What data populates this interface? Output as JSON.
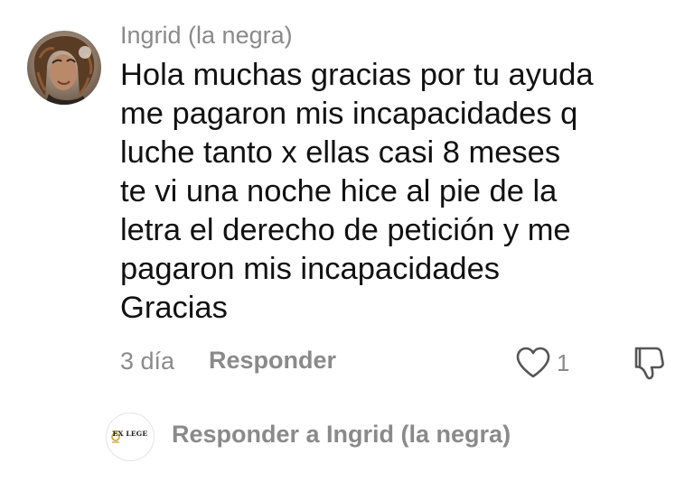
{
  "comment": {
    "author": "Ingrid (la negra)",
    "text": "Hola muchas gracias por tu ayuda\nme pagaron mis incapacidades q\nluche tanto x ellas casi 8 meses\nte vi una noche hice al pie de la\nletra el derecho de petición y me\npagaron mis incapacidades\nGracias",
    "time": "3 día",
    "reply_label": "Responder",
    "like_count": "1"
  },
  "reply_box": {
    "avatar_logo_text": "EX LEGE",
    "placeholder": "Responder a Ingrid (la negra)"
  },
  "icons": {
    "like": "heart-outline-icon",
    "dislike": "thumbs-down-outline-icon"
  },
  "colors": {
    "text": "#111111",
    "muted": "#8a8a8a",
    "background": "#ffffff"
  }
}
